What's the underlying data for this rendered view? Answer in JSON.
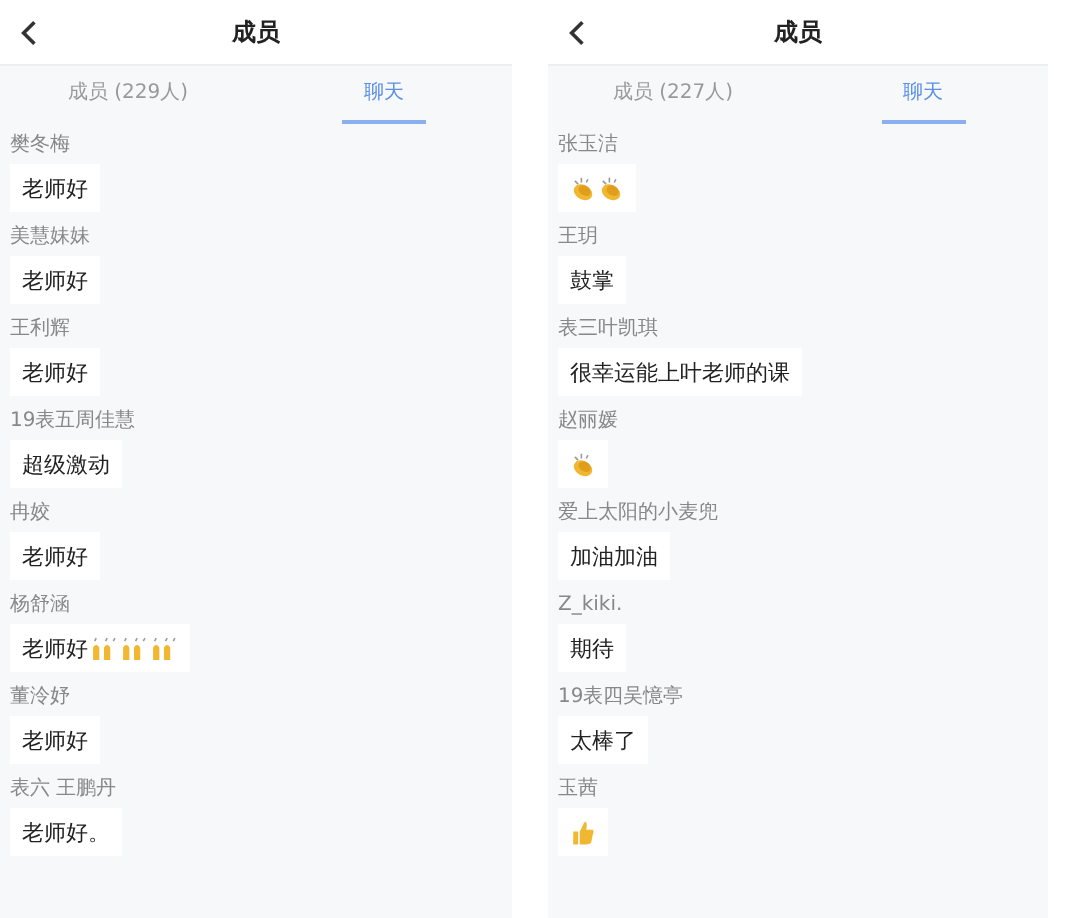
{
  "screens": [
    {
      "title": "成员",
      "tabs": [
        {
          "label": "成员 (229人)",
          "selected": false
        },
        {
          "label": "聊天",
          "selected": true
        }
      ],
      "messages": [
        {
          "sender": "樊冬梅",
          "text": "老师好"
        },
        {
          "sender": "美慧妹妹",
          "text": "老师好"
        },
        {
          "sender": "王利辉",
          "text": "老师好"
        },
        {
          "sender": "19表五周佳慧",
          "text": "超级激动"
        },
        {
          "sender": "冉姣",
          "text": "老师好"
        },
        {
          "sender": "杨舒涵",
          "text": "老师好",
          "emoji": [
            {
              "kind": "raised-hands"
            },
            {
              "kind": "raised-hands"
            },
            {
              "kind": "raised-hands"
            }
          ]
        },
        {
          "sender": "董泠妤",
          "text": "老师好"
        },
        {
          "sender": "表六  王鹏丹",
          "text": "老师好。"
        }
      ]
    },
    {
      "title": "成员",
      "tabs": [
        {
          "label": "成员 (227人)",
          "selected": false
        },
        {
          "label": "聊天",
          "selected": true
        }
      ],
      "messages": [
        {
          "sender": "张玉洁",
          "emoji": [
            {
              "kind": "clap"
            },
            {
              "kind": "clap"
            }
          ]
        },
        {
          "sender": "王玥",
          "text": "鼓掌"
        },
        {
          "sender": "表三叶凯琪",
          "text": "很幸运能上叶老师的课"
        },
        {
          "sender": "赵丽媛",
          "emoji": [
            {
              "kind": "clap"
            }
          ]
        },
        {
          "sender": "爱上太阳的小麦兜",
          "text": "加油加油"
        },
        {
          "sender": "Z_kiki.",
          "text": "期待"
        },
        {
          "sender": "19表四吴憶亭",
          "text": "太棒了"
        },
        {
          "sender": "玉茜",
          "emoji": [
            {
              "kind": "thumbs-up"
            }
          ]
        }
      ]
    }
  ]
}
